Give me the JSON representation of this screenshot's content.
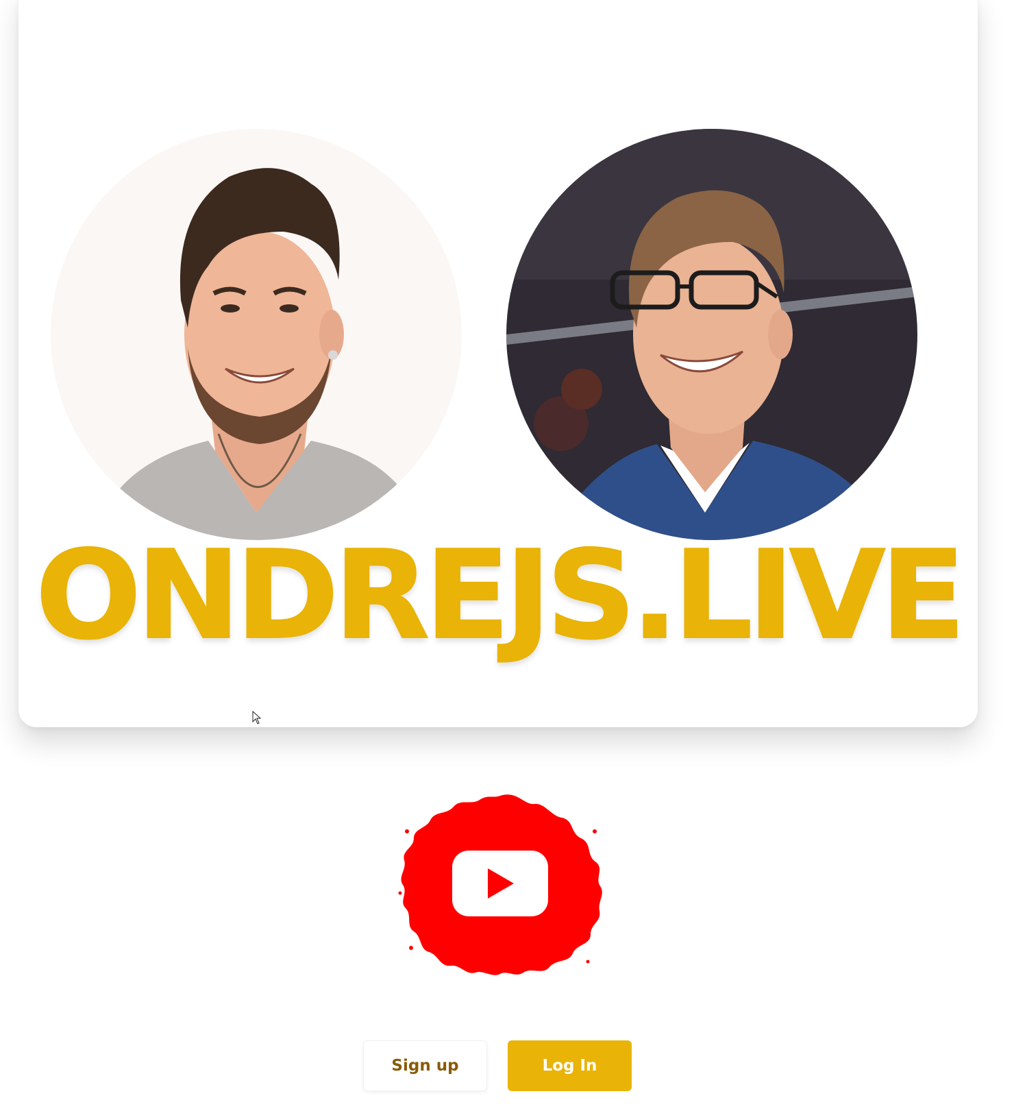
{
  "hero": {
    "title": "ONDREJS.LIVE",
    "avatars": [
      {
        "name": "host-photo-left",
        "background": "#fbf7f5"
      },
      {
        "name": "host-photo-right",
        "background": "#2f2a33"
      }
    ]
  },
  "social": {
    "youtube_icon": "youtube-splash-icon",
    "color": "#ff0000"
  },
  "auth": {
    "signup_label": "Sign up",
    "login_label": "Log In"
  },
  "theme": {
    "accent": "#e9b307",
    "signup_text": "#8a5a08"
  }
}
